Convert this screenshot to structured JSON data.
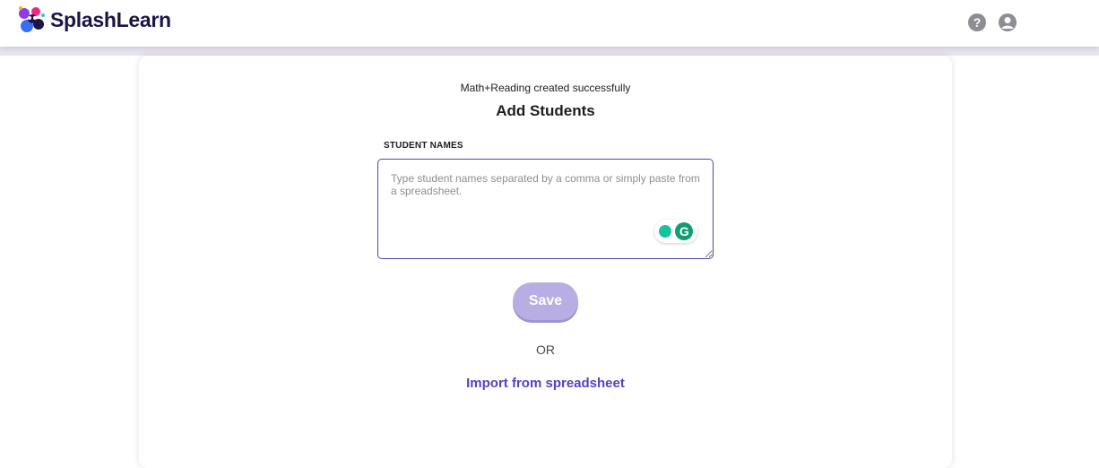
{
  "header": {
    "brand_name": "SplashLearn",
    "help_icon": "question-circle-icon",
    "account_icon": "user-circle-icon"
  },
  "main": {
    "success_message": "Math+Reading created successfully",
    "title": "Add Students",
    "student_names": {
      "label": "STUDENT NAMES",
      "placeholder": "Type student names separated by a comma or simply paste from a spreadsheet.",
      "value": ""
    },
    "save_label": "Save",
    "or_text": "OR",
    "import_label": "Import from spreadsheet"
  },
  "colors": {
    "accent": "#5a3fc0",
    "save_button": "#b8aee3",
    "band": "#e8e3f3"
  }
}
